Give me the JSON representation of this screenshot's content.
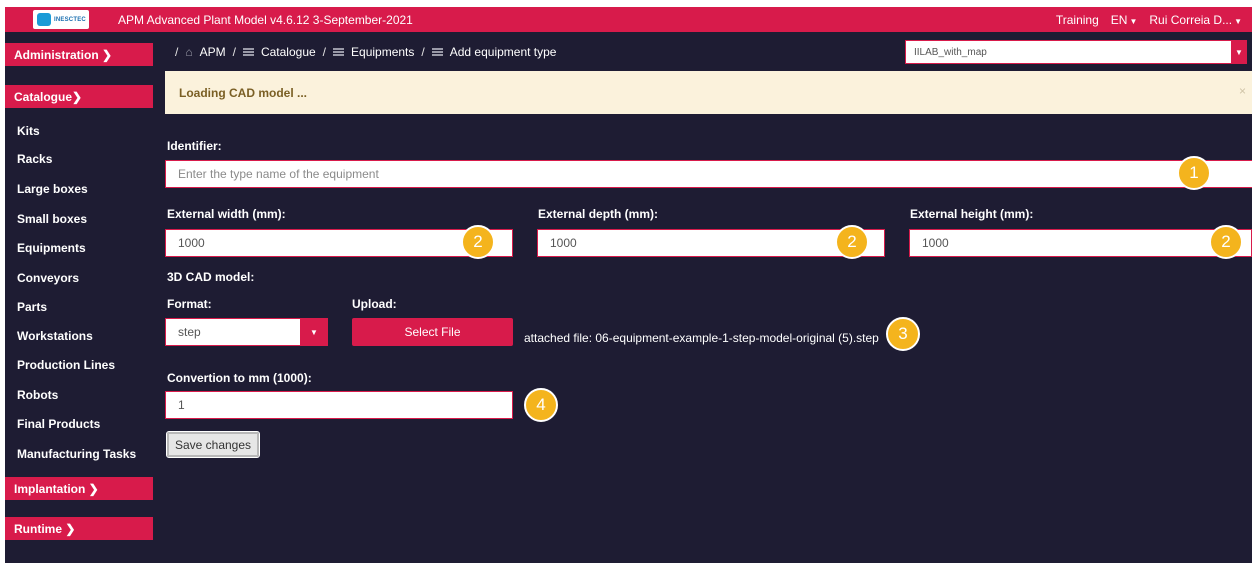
{
  "topbar": {
    "logo_text": "INESCTEC",
    "app_title": "APM Advanced Plant Model   v4.6.12   3-September-2021",
    "training": "Training",
    "language": "EN",
    "user": "Rui Correia D..."
  },
  "sidebar": {
    "administration": "Administration ❯",
    "catalogue": "Catalogue❯",
    "items": [
      {
        "label": "Kits"
      },
      {
        "label": "Racks"
      },
      {
        "label": "Large boxes"
      },
      {
        "label": "Small boxes"
      },
      {
        "label": "Equipments"
      },
      {
        "label": "Conveyors"
      },
      {
        "label": "Parts"
      },
      {
        "label": "Workstations"
      },
      {
        "label": "Production Lines"
      },
      {
        "label": "Robots"
      },
      {
        "label": "Final Products"
      },
      {
        "label": "Manufacturing Tasks"
      }
    ],
    "implantation": "Implantation ❯",
    "runtime": "Runtime ❯"
  },
  "breadcrumb": {
    "root_sep": "/",
    "apm": "APM",
    "catalogue": "Catalogue",
    "equipments": "Equipments",
    "current": "Add equipment type"
  },
  "site_select": {
    "value": "IILAB_with_map"
  },
  "alert": {
    "message": "Loading CAD model ...",
    "close": "×"
  },
  "form": {
    "identifier_label": "Identifier:",
    "identifier_placeholder": "Enter the type name of the equipment",
    "width_label": "External width (mm):",
    "width_value": "1000",
    "depth_label": "External depth (mm):",
    "depth_value": "1000",
    "height_label": "External height (mm):",
    "height_value": "1000",
    "cad_label": "3D CAD model:",
    "format_label": "Format:",
    "format_value": "step",
    "upload_label": "Upload:",
    "select_file": "Select File",
    "attached_file": "attached file: 06-equipment-example-1-step-model-original (5).step",
    "convertion_label": "Convertion to mm (1000):",
    "convertion_value": "1",
    "save": "Save changes"
  },
  "badges": {
    "b1": "1",
    "b2": "2",
    "b3": "3",
    "b4": "4"
  },
  "colors": {
    "accent": "#d81b4b",
    "background": "#1e1c33",
    "alert_bg": "#fbf2dc",
    "badge": "#f4b41d"
  }
}
